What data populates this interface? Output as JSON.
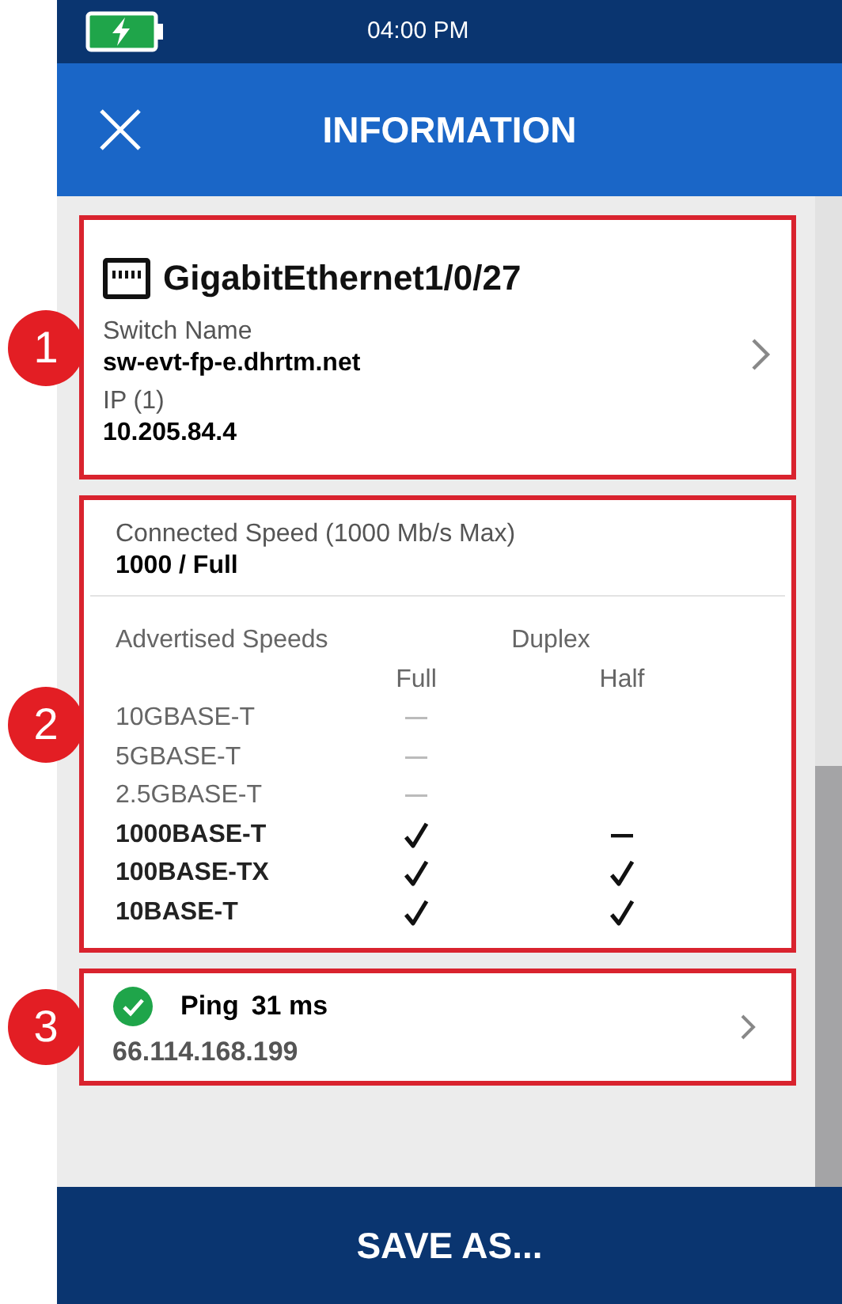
{
  "status_bar": {
    "time": "04:00 PM",
    "charging": true
  },
  "header": {
    "title": "INFORMATION"
  },
  "sections": [
    {
      "callout": "1",
      "kind": "switch",
      "port": "GigabitEthernet1/0/27",
      "fields": [
        {
          "label": "Switch Name",
          "value": "sw-evt-fp-e.dhrtm.net"
        },
        {
          "label": "IP (1)",
          "value": "10.205.84.4"
        }
      ]
    },
    {
      "callout": "2",
      "kind": "speeds",
      "connected_label": "Connected Speed (1000 Mb/s Max)",
      "connected_value": "1000 / Full",
      "speeds_heading": "Advertised Speeds",
      "duplex_heading": "Duplex",
      "full_heading": "Full",
      "half_heading": "Half",
      "rows": [
        {
          "name": "10GBASE-T",
          "supported": false,
          "full": {
            "kind": "dash"
          }
        },
        {
          "name": "5GBASE-T",
          "supported": false,
          "full": {
            "kind": "dash"
          }
        },
        {
          "name": "2.5GBASE-T",
          "supported": false,
          "full": {
            "kind": "dash"
          }
        },
        {
          "name": "1000BASE-T",
          "supported": true,
          "full": {
            "kind": "check"
          },
          "half": {
            "kind": "dash"
          }
        },
        {
          "name": "100BASE-TX",
          "supported": true,
          "full": {
            "kind": "check"
          },
          "half": {
            "kind": "check"
          }
        },
        {
          "name": "10BASE-T",
          "supported": true,
          "full": {
            "kind": "check"
          },
          "half": {
            "kind": "check"
          }
        }
      ]
    },
    {
      "callout": "3",
      "kind": "ping",
      "ok": true,
      "label": "Ping",
      "time": "31 ms",
      "address": "66.114.168.199"
    }
  ],
  "footer": {
    "button": "SAVE AS..."
  }
}
